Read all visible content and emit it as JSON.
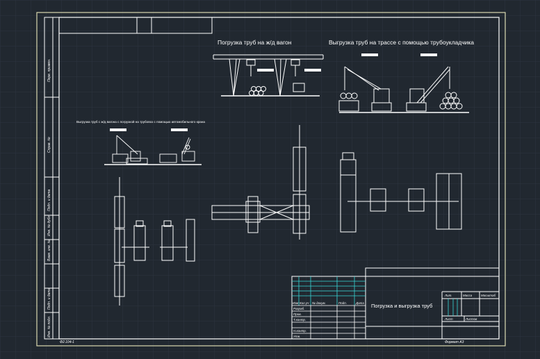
{
  "drawing": {
    "title_gantry": "Погрузка труб на ж/д вагон",
    "title_pipelayer": "Выгрузка труб на трассе с помощью трубоукладчика",
    "title_crane": "Выгрузка труб с ж/д вагона с погрузкой на трубовоз с помощью автомобильного крана"
  },
  "title_block": {
    "main_title": "Погрузка и выгрузка труб",
    "col_izm": "Изм",
    "col_kol": "Кол.уч",
    "col_list": "Лист",
    "col_doc": "№ докум.",
    "col_podp": "Подп.",
    "col_date": "Дата",
    "row_razrab": "Разраб.",
    "row_prov": "Пров.",
    "row_tkontr": "Т.контр.",
    "row_nkontr": "Н.контр.",
    "row_utv": "Утв.",
    "lit": "Лит.",
    "massa": "Масса",
    "masshtab": "Масштаб",
    "list": "Лист",
    "listov": "Листов"
  },
  "frame": {
    "bottom_left": "Ф2.104-1",
    "bottom_right": "Формат А3"
  },
  "side_stamp": {
    "perv_primen": "Перв. примен.",
    "sprav_no": "Справ. №",
    "podp_data_1": "Подп. и дата",
    "inv_dubl": "Инв. № дубл.",
    "vzam_inv": "Взам. инв. №",
    "podp_data_2": "Подп. и дата",
    "inv_podl": "Инв. № подл."
  },
  "colors": {
    "background": "#212830",
    "lines": "#ffffff",
    "frame": "#d9d9b0",
    "table_cyan": "#37d6d6"
  }
}
